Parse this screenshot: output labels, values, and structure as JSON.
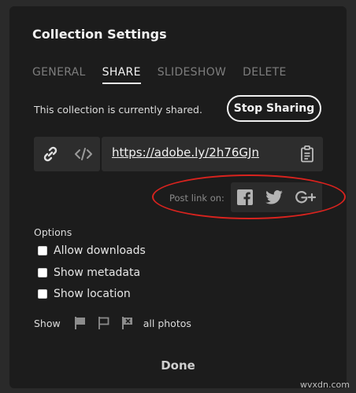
{
  "dialog": {
    "title": "Collection Settings",
    "tabs": [
      {
        "label": "GENERAL",
        "active": false
      },
      {
        "label": "SHARE",
        "active": true
      },
      {
        "label": "SLIDESHOW",
        "active": false
      },
      {
        "label": "DELETE",
        "active": false
      }
    ]
  },
  "share": {
    "status_text": "This collection is currently shared.",
    "stop_button": "Stop Sharing",
    "link_icons": [
      "link-icon",
      "code-embed-icon"
    ],
    "url": "https://adobe.ly/2h76GJn",
    "copy_icon": "clipboard-icon",
    "post_label": "Post link on:",
    "social_icons": [
      "facebook-icon",
      "twitter-icon",
      "google-plus-icon"
    ]
  },
  "options": {
    "heading": "Options",
    "items": [
      {
        "label": "Allow downloads",
        "checked": false
      },
      {
        "label": "Show metadata",
        "checked": false
      },
      {
        "label": "Show location",
        "checked": false
      }
    ]
  },
  "show": {
    "label": "Show",
    "flag_icons": [
      "flag-filled-icon",
      "flag-outline-icon",
      "flag-rejected-icon"
    ],
    "suffix": "all photos"
  },
  "footer": {
    "done_button": "Done",
    "watermark": "wvxdn.com"
  },
  "colors": {
    "background": "#1c1c1c",
    "field": "#2d2d2d",
    "annotation_circle": "#d8231e"
  }
}
